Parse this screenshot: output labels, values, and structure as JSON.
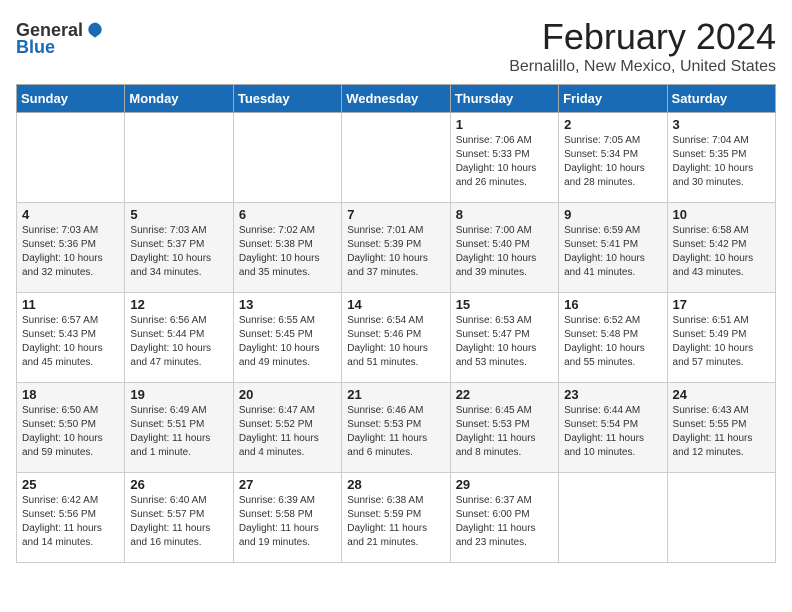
{
  "logo": {
    "general": "General",
    "blue": "Blue"
  },
  "header": {
    "month_year": "February 2024",
    "location": "Bernalillo, New Mexico, United States"
  },
  "days_of_week": [
    "Sunday",
    "Monday",
    "Tuesday",
    "Wednesday",
    "Thursday",
    "Friday",
    "Saturday"
  ],
  "weeks": [
    [
      {
        "day": "",
        "detail": ""
      },
      {
        "day": "",
        "detail": ""
      },
      {
        "day": "",
        "detail": ""
      },
      {
        "day": "",
        "detail": ""
      },
      {
        "day": "1",
        "detail": "Sunrise: 7:06 AM\nSunset: 5:33 PM\nDaylight: 10 hours\nand 26 minutes."
      },
      {
        "day": "2",
        "detail": "Sunrise: 7:05 AM\nSunset: 5:34 PM\nDaylight: 10 hours\nand 28 minutes."
      },
      {
        "day": "3",
        "detail": "Sunrise: 7:04 AM\nSunset: 5:35 PM\nDaylight: 10 hours\nand 30 minutes."
      }
    ],
    [
      {
        "day": "4",
        "detail": "Sunrise: 7:03 AM\nSunset: 5:36 PM\nDaylight: 10 hours\nand 32 minutes."
      },
      {
        "day": "5",
        "detail": "Sunrise: 7:03 AM\nSunset: 5:37 PM\nDaylight: 10 hours\nand 34 minutes."
      },
      {
        "day": "6",
        "detail": "Sunrise: 7:02 AM\nSunset: 5:38 PM\nDaylight: 10 hours\nand 35 minutes."
      },
      {
        "day": "7",
        "detail": "Sunrise: 7:01 AM\nSunset: 5:39 PM\nDaylight: 10 hours\nand 37 minutes."
      },
      {
        "day": "8",
        "detail": "Sunrise: 7:00 AM\nSunset: 5:40 PM\nDaylight: 10 hours\nand 39 minutes."
      },
      {
        "day": "9",
        "detail": "Sunrise: 6:59 AM\nSunset: 5:41 PM\nDaylight: 10 hours\nand 41 minutes."
      },
      {
        "day": "10",
        "detail": "Sunrise: 6:58 AM\nSunset: 5:42 PM\nDaylight: 10 hours\nand 43 minutes."
      }
    ],
    [
      {
        "day": "11",
        "detail": "Sunrise: 6:57 AM\nSunset: 5:43 PM\nDaylight: 10 hours\nand 45 minutes."
      },
      {
        "day": "12",
        "detail": "Sunrise: 6:56 AM\nSunset: 5:44 PM\nDaylight: 10 hours\nand 47 minutes."
      },
      {
        "day": "13",
        "detail": "Sunrise: 6:55 AM\nSunset: 5:45 PM\nDaylight: 10 hours\nand 49 minutes."
      },
      {
        "day": "14",
        "detail": "Sunrise: 6:54 AM\nSunset: 5:46 PM\nDaylight: 10 hours\nand 51 minutes."
      },
      {
        "day": "15",
        "detail": "Sunrise: 6:53 AM\nSunset: 5:47 PM\nDaylight: 10 hours\nand 53 minutes."
      },
      {
        "day": "16",
        "detail": "Sunrise: 6:52 AM\nSunset: 5:48 PM\nDaylight: 10 hours\nand 55 minutes."
      },
      {
        "day": "17",
        "detail": "Sunrise: 6:51 AM\nSunset: 5:49 PM\nDaylight: 10 hours\nand 57 minutes."
      }
    ],
    [
      {
        "day": "18",
        "detail": "Sunrise: 6:50 AM\nSunset: 5:50 PM\nDaylight: 10 hours\nand 59 minutes."
      },
      {
        "day": "19",
        "detail": "Sunrise: 6:49 AM\nSunset: 5:51 PM\nDaylight: 11 hours\nand 1 minute."
      },
      {
        "day": "20",
        "detail": "Sunrise: 6:47 AM\nSunset: 5:52 PM\nDaylight: 11 hours\nand 4 minutes."
      },
      {
        "day": "21",
        "detail": "Sunrise: 6:46 AM\nSunset: 5:53 PM\nDaylight: 11 hours\nand 6 minutes."
      },
      {
        "day": "22",
        "detail": "Sunrise: 6:45 AM\nSunset: 5:53 PM\nDaylight: 11 hours\nand 8 minutes."
      },
      {
        "day": "23",
        "detail": "Sunrise: 6:44 AM\nSunset: 5:54 PM\nDaylight: 11 hours\nand 10 minutes."
      },
      {
        "day": "24",
        "detail": "Sunrise: 6:43 AM\nSunset: 5:55 PM\nDaylight: 11 hours\nand 12 minutes."
      }
    ],
    [
      {
        "day": "25",
        "detail": "Sunrise: 6:42 AM\nSunset: 5:56 PM\nDaylight: 11 hours\nand 14 minutes."
      },
      {
        "day": "26",
        "detail": "Sunrise: 6:40 AM\nSunset: 5:57 PM\nDaylight: 11 hours\nand 16 minutes."
      },
      {
        "day": "27",
        "detail": "Sunrise: 6:39 AM\nSunset: 5:58 PM\nDaylight: 11 hours\nand 19 minutes."
      },
      {
        "day": "28",
        "detail": "Sunrise: 6:38 AM\nSunset: 5:59 PM\nDaylight: 11 hours\nand 21 minutes."
      },
      {
        "day": "29",
        "detail": "Sunrise: 6:37 AM\nSunset: 6:00 PM\nDaylight: 11 hours\nand 23 minutes."
      },
      {
        "day": "",
        "detail": ""
      },
      {
        "day": "",
        "detail": ""
      }
    ]
  ]
}
